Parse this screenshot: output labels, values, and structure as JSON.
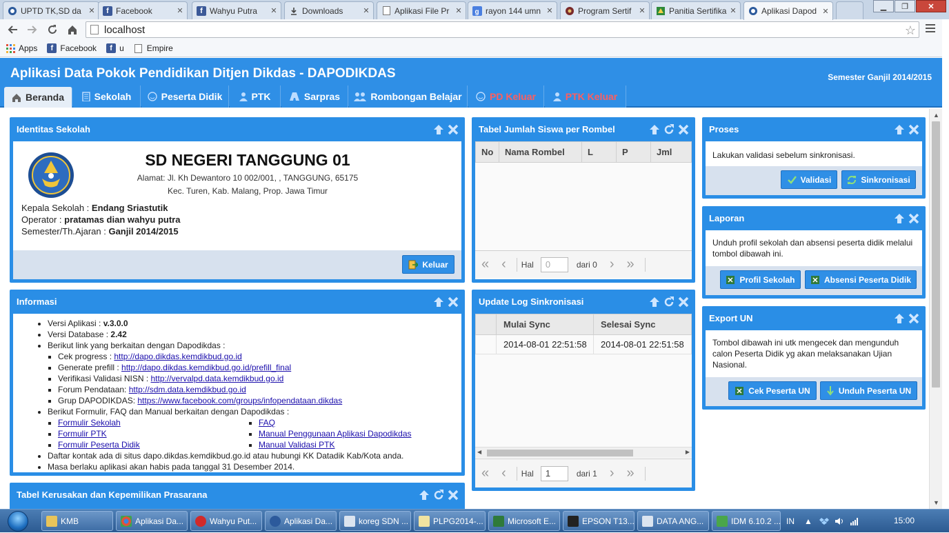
{
  "browser": {
    "tabs": [
      {
        "title": "UPTD TK,SD da",
        "icon": "garuda-icon"
      },
      {
        "title": "Facebook",
        "icon": "facebook-icon"
      },
      {
        "title": "Wahyu Putra",
        "icon": "facebook-icon"
      },
      {
        "title": "Downloads",
        "icon": "download-icon"
      },
      {
        "title": "Aplikasi File Pr",
        "icon": "page-icon"
      },
      {
        "title": "rayon 144 umn",
        "icon": "google-icon"
      },
      {
        "title": "Program Sertif",
        "icon": "emblem-icon"
      },
      {
        "title": "Panitia Sertifika",
        "icon": "green-emblem-icon"
      },
      {
        "title": "Aplikasi Dapod",
        "icon": "garuda-icon",
        "active": true
      }
    ],
    "url": "localhost",
    "bookmarks": [
      "Apps",
      "Facebook",
      "u",
      "Empire"
    ]
  },
  "app": {
    "title": "Aplikasi Data Pokok Pendidikan Ditjen Dikdas - DAPODIKDAS",
    "semester": "Semester Ganjil 2014/2015",
    "nav": [
      "Beranda",
      "Sekolah",
      "Peserta Didik",
      "PTK",
      "Sarpras",
      "Rombongan Belajar",
      "PD Keluar",
      "PTK Keluar"
    ]
  },
  "identitas": {
    "title": "Identitas Sekolah",
    "school_name": "SD NEGERI TANGGUNG 01",
    "address1": "Alamat: Jl. Kh Dewantoro 10 002/001, , TANGGUNG, 65175",
    "address2": "Kec. Turen, Kab. Malang, Prop. Jawa Timur",
    "kepala_label": "Kepala Sekolah : ",
    "kepala": "Endang Sriastutik",
    "operator_label": "Operator : ",
    "operator": "pratamas dian wahyu putra",
    "semester_label": "Semester/Th.Ajaran : ",
    "semester": "Ganjil 2014/2015",
    "keluar": "Keluar"
  },
  "rombel": {
    "title": "Tabel Jumlah Siswa per Rombel",
    "columns": [
      "No",
      "Nama Rombel",
      "L",
      "P",
      "Jml"
    ],
    "hal": "Hal",
    "page": "0",
    "dari": "dari 0"
  },
  "proses": {
    "title": "Proses",
    "text": "Lakukan validasi sebelum sinkronisasi.",
    "validasi": "Validasi",
    "sinkronisasi": "Sinkronisasi"
  },
  "laporan": {
    "title": "Laporan",
    "text": "Unduh profil sekolah dan absensi peserta didik melalui tombol dibawah ini.",
    "profil": "Profil Sekolah",
    "absensi": "Absensi Peserta Didik"
  },
  "export": {
    "title": "Export UN",
    "text": "Tombol dibawah ini utk mengecek dan mengunduh calon Peserta Didik yg akan melaksanakan Ujian Nasional.",
    "cek": "Cek Peserta UN",
    "unduh": "Unduh Peserta UN"
  },
  "informasi": {
    "title": "Informasi",
    "versi_app_label": "Versi Aplikasi : ",
    "versi_app": "v.3.0.0",
    "versi_db_label": "Versi Database : ",
    "versi_db": "2.42",
    "links_intro": "Berikut link yang berkaitan dengan Dapodikdas :",
    "links": [
      {
        "label": "Cek progress : ",
        "url": "http://dapo.dikdas.kemdikbud.go.id"
      },
      {
        "label": "Generate prefill : ",
        "url": "http://dapo.dikdas.kemdikbud.go.id/prefill_final"
      },
      {
        "label": "Verifikasi Validasi NISN : ",
        "url": "http://vervalpd.data.kemdikbud.go.id"
      },
      {
        "label": "Forum Pendataan: ",
        "url": "http://sdm.data.kemdikbud.go.id"
      },
      {
        "label": "Grup DAPODIKDAS: ",
        "url": "https://www.facebook.com/groups/infopendataan.dikdas"
      }
    ],
    "forms_intro": "Berikut Formulir, FAQ dan Manual berkaitan dengan Dapodikdas :",
    "forms_left": [
      "Formulir Sekolah",
      "Formulir PTK",
      "Formulir Peserta Didik"
    ],
    "forms_right": [
      "FAQ",
      "Manual Penggunaan Aplikasi Dapodikdas",
      "Manual Validasi PTK"
    ],
    "kontak": "Daftar kontak ada di situs dapo.dikdas.kemdikbud.go.id atau hubungi KK Datadik Kab/Kota anda.",
    "masa": "Masa berlaku aplikasi akan habis pada tanggal 31 Desember 2014."
  },
  "updatelog": {
    "title": "Update Log Sinkronisasi",
    "columns": [
      "Mulai Sync",
      "Selesai Sync"
    ],
    "rows": [
      [
        "2014-08-01 22:51:58",
        "2014-08-01 22:51:58"
      ]
    ],
    "hal": "Hal",
    "page": "1",
    "dari": "dari 1"
  },
  "kerusakan": {
    "title": "Tabel Kerusakan dan Kepemilikan Prasarana"
  },
  "taskbar": {
    "items": [
      "KMB",
      "Aplikasi Da...",
      "Wahyu Put...",
      "Aplikasi Da...",
      "koreg SDN ...",
      "PLPG2014-...",
      "Microsoft E...",
      "EPSON T13...",
      "DATA ANG...",
      "IDM 6.10.2 ..."
    ],
    "lang": "IN",
    "time": "15:00"
  },
  "colors": {
    "accent": "#2f8fe6",
    "panel": "#2a8ee6",
    "danger": "#ff5e5e"
  }
}
